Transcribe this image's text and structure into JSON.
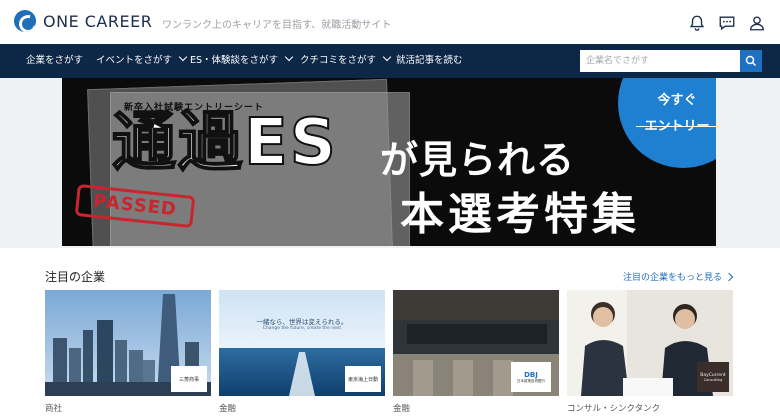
{
  "header": {
    "logo_text": "ONE CAREER",
    "tagline": "ワンランク上のキャリアを目指す、就職活動サイト",
    "icons": [
      "bell-icon",
      "chat-icon",
      "user-icon"
    ]
  },
  "nav": {
    "items": [
      {
        "label": "企業をさがす",
        "has_dropdown": false
      },
      {
        "label": "イベントをさがす",
        "has_dropdown": true
      },
      {
        "label": "ES・体験談をさがす",
        "has_dropdown": true
      },
      {
        "label": "クチコミをさがす",
        "has_dropdown": true
      },
      {
        "label": "就活記事を読む",
        "has_dropdown": false
      }
    ],
    "search_placeholder": "企業名でさがす"
  },
  "banner": {
    "sheet_heading": "新卒入社試験エントリーシート",
    "stamp": "PASSED",
    "line1": "通過ES",
    "line2": "が見られる",
    "line3": "本選考特集",
    "cta_line1": "今すぐ",
    "cta_line2": "エントリー"
  },
  "featured": {
    "title": "注目の企業",
    "more_link": "注目の企業をもっと見る",
    "cards": [
      {
        "category": "商社",
        "logo_text": "三菱商事"
      },
      {
        "category": "金融",
        "logo_text": "東京海上日動",
        "image_caption_1": "一緒なら、世界は変えられる。",
        "image_caption_2": "Change the future, create the next"
      },
      {
        "category": "金融",
        "logo_text": "DBJ",
        "logo_sub": "日本政策投資銀行"
      },
      {
        "category": "コンサル・シンクタンク",
        "logo_text": "BayCurrent",
        "logo_sub": "Consulting"
      }
    ]
  },
  "colors": {
    "nav_bg": "#0d2747",
    "accent": "#1f6fc3",
    "cta": "#1f7fd0",
    "stamp": "#c8262e"
  }
}
